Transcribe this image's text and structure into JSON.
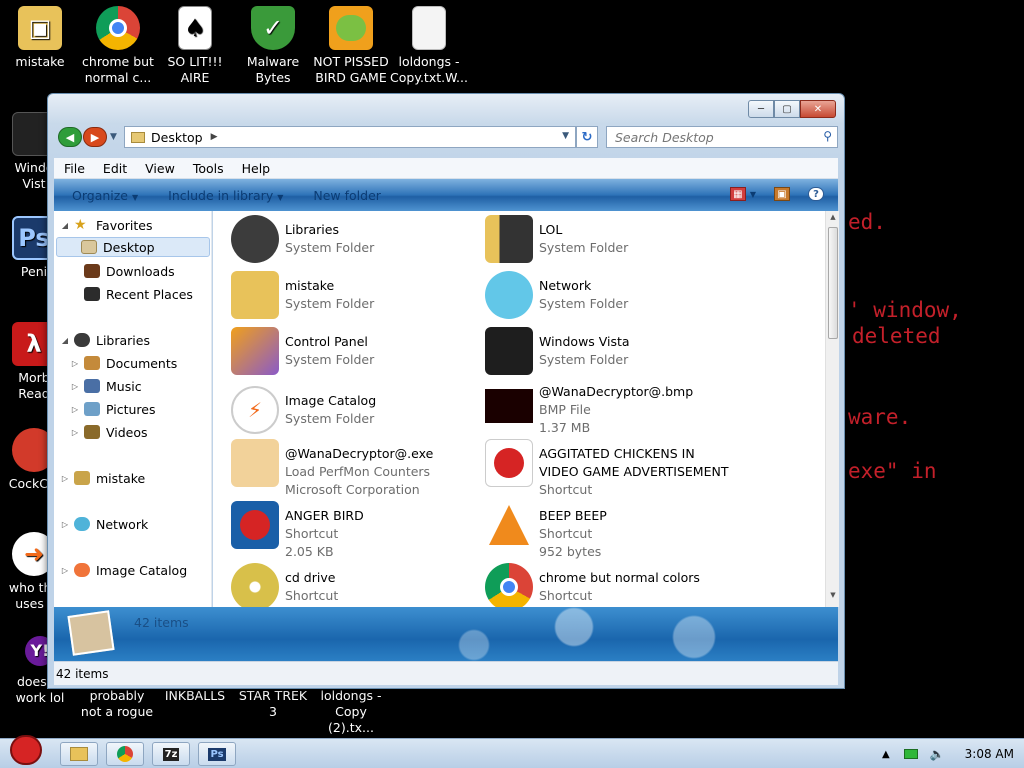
{
  "desktop": {
    "background_text": [
      "ed.",
      "' window,",
      "deleted",
      "ware.",
      "exe\" in"
    ],
    "icons_top": [
      {
        "label1": "mistake",
        "label2": ""
      },
      {
        "label1": "chrome but",
        "label2": "normal c..."
      },
      {
        "label1": "SO LIT!!!",
        "label2": "AIRE"
      },
      {
        "label1": "Malware",
        "label2": "Bytes"
      },
      {
        "label1": "NOT PISSED",
        "label2": "BIRD GAME"
      },
      {
        "label1": "loldongs -",
        "label2": "Copy.txt.W..."
      }
    ],
    "icons_left": [
      {
        "label1": "Windo",
        "label2": "Vist"
      },
      {
        "label1": "Peni",
        "label2": ""
      },
      {
        "label1": "Morb",
        "label2": "Read"
      },
      {
        "label1": "CockCle",
        "label2": ""
      },
      {
        "label1": "who the",
        "label2": "uses t"
      }
    ],
    "icons_bottom": [
      {
        "label1": "doesn't",
        "label2": "work lol"
      },
      {
        "label1": "probably",
        "label2": "not a rogue"
      },
      {
        "label1": "INKBALLS",
        "label2": ""
      },
      {
        "label1": "STAR TREK",
        "label2": "3"
      },
      {
        "label1": "loldongs -",
        "label2": "Copy (2).tx..."
      }
    ]
  },
  "window": {
    "address": "Desktop",
    "search_placeholder": "Search Desktop",
    "menu": [
      "File",
      "Edit",
      "View",
      "Tools",
      "Help"
    ],
    "commands": [
      "Organize",
      "Include in library",
      "New folder"
    ],
    "nav": [
      {
        "label": "Favorites",
        "indent": 0,
        "expander": "open",
        "selected": false
      },
      {
        "label": "Desktop",
        "indent": 1,
        "expander": "",
        "selected": true
      },
      {
        "label": "Downloads",
        "indent": 1,
        "expander": "",
        "selected": false
      },
      {
        "label": "Recent Places",
        "indent": 1,
        "expander": "",
        "selected": false
      },
      {
        "label": "Libraries",
        "indent": 0,
        "expander": "open",
        "selected": false
      },
      {
        "label": "Documents",
        "indent": 1,
        "expander": "closed",
        "selected": false
      },
      {
        "label": "Music",
        "indent": 1,
        "expander": "closed",
        "selected": false
      },
      {
        "label": "Pictures",
        "indent": 1,
        "expander": "closed",
        "selected": false
      },
      {
        "label": "Videos",
        "indent": 1,
        "expander": "closed",
        "selected": false
      },
      {
        "label": "mistake",
        "indent": 0,
        "expander": "closed",
        "selected": false
      },
      {
        "label": "Network",
        "indent": 0,
        "expander": "closed",
        "selected": false
      },
      {
        "label": "Image Catalog",
        "indent": 0,
        "expander": "closed",
        "selected": false
      }
    ],
    "items": [
      {
        "name": "Libraries",
        "sub1": "System Folder",
        "sub2": ""
      },
      {
        "name": "LOL",
        "sub1": "System Folder",
        "sub2": ""
      },
      {
        "name": "mistake",
        "sub1": "System Folder",
        "sub2": ""
      },
      {
        "name": "Network",
        "sub1": "System Folder",
        "sub2": ""
      },
      {
        "name": "Control Panel",
        "sub1": "System Folder",
        "sub2": ""
      },
      {
        "name": "Windows Vista",
        "sub1": "System Folder",
        "sub2": ""
      },
      {
        "name": "Image Catalog",
        "sub1": "System Folder",
        "sub2": ""
      },
      {
        "name": "@WanaDecryptor@.bmp",
        "sub1": "BMP File",
        "sub2": "1.37 MB"
      },
      {
        "name": "@WanaDecryptor@.exe",
        "sub1": "Load PerfMon Counters",
        "sub2": "Microsoft Corporation"
      },
      {
        "name": "AGGITATED CHICKENS IN",
        "name2": "VIDEO GAME ADVERTISEMENT",
        "sub1": "Shortcut",
        "sub2": ""
      },
      {
        "name": "ANGER BIRD",
        "sub1": "Shortcut",
        "sub2": "2.05 KB"
      },
      {
        "name": "BEEP BEEP",
        "sub1": "Shortcut",
        "sub2": "952 bytes"
      },
      {
        "name": "cd drive",
        "sub1": "Shortcut",
        "sub2": ""
      },
      {
        "name": "chrome but normal colors",
        "sub1": "Shortcut",
        "sub2": ""
      }
    ],
    "details_count": "42 items",
    "status_count": "42 items"
  },
  "taskbar": {
    "clock": "3:08 AM",
    "task_labels": [
      "",
      "",
      "7z",
      "Ps"
    ]
  }
}
